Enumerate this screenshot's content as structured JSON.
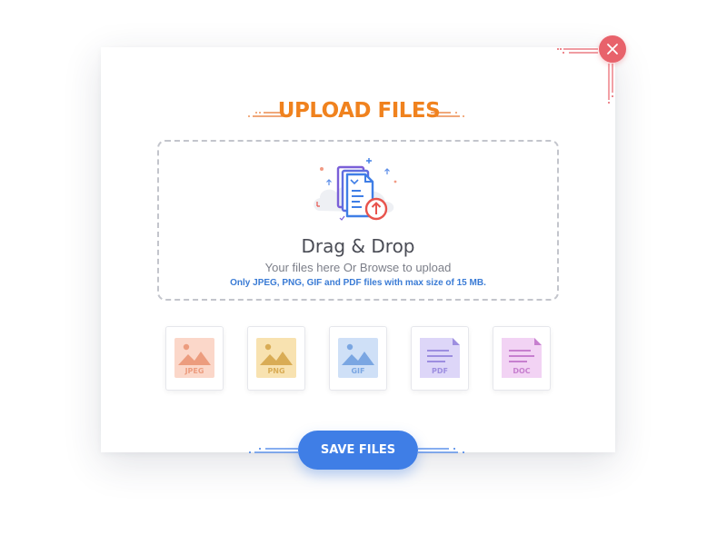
{
  "dialog": {
    "title": "UPLOAD FILES",
    "close_icon": "close-icon"
  },
  "dropzone": {
    "illustration_icon": "document-upload-icon",
    "title": "Drag & Drop",
    "subtitle": "Your files here Or Browse to upload",
    "note": "Only JPEG, PNG, GIF and PDF files with max size of 15 MB."
  },
  "file_types": [
    {
      "label": "JPEG",
      "icon": "image-icon",
      "bg": "#fbd7c9",
      "fg": "#ec9c7e"
    },
    {
      "label": "PNG",
      "icon": "image-icon",
      "bg": "#f8e2b0",
      "fg": "#d9ac55"
    },
    {
      "label": "GIF",
      "icon": "image-icon",
      "bg": "#cfe0f7",
      "fg": "#7aa6e2"
    },
    {
      "label": "PDF",
      "icon": "document-icon",
      "bg": "#ddd6f8",
      "fg": "#9d8ee0"
    },
    {
      "label": "DOC",
      "icon": "document-icon",
      "bg": "#f2d3f4",
      "fg": "#c77fcf"
    }
  ],
  "actions": {
    "save_label": "SAVE FILES"
  },
  "colors": {
    "accent_blue": "#3f7ee6",
    "title_orange": "#f0821e",
    "close_red": "#e8626b"
  }
}
